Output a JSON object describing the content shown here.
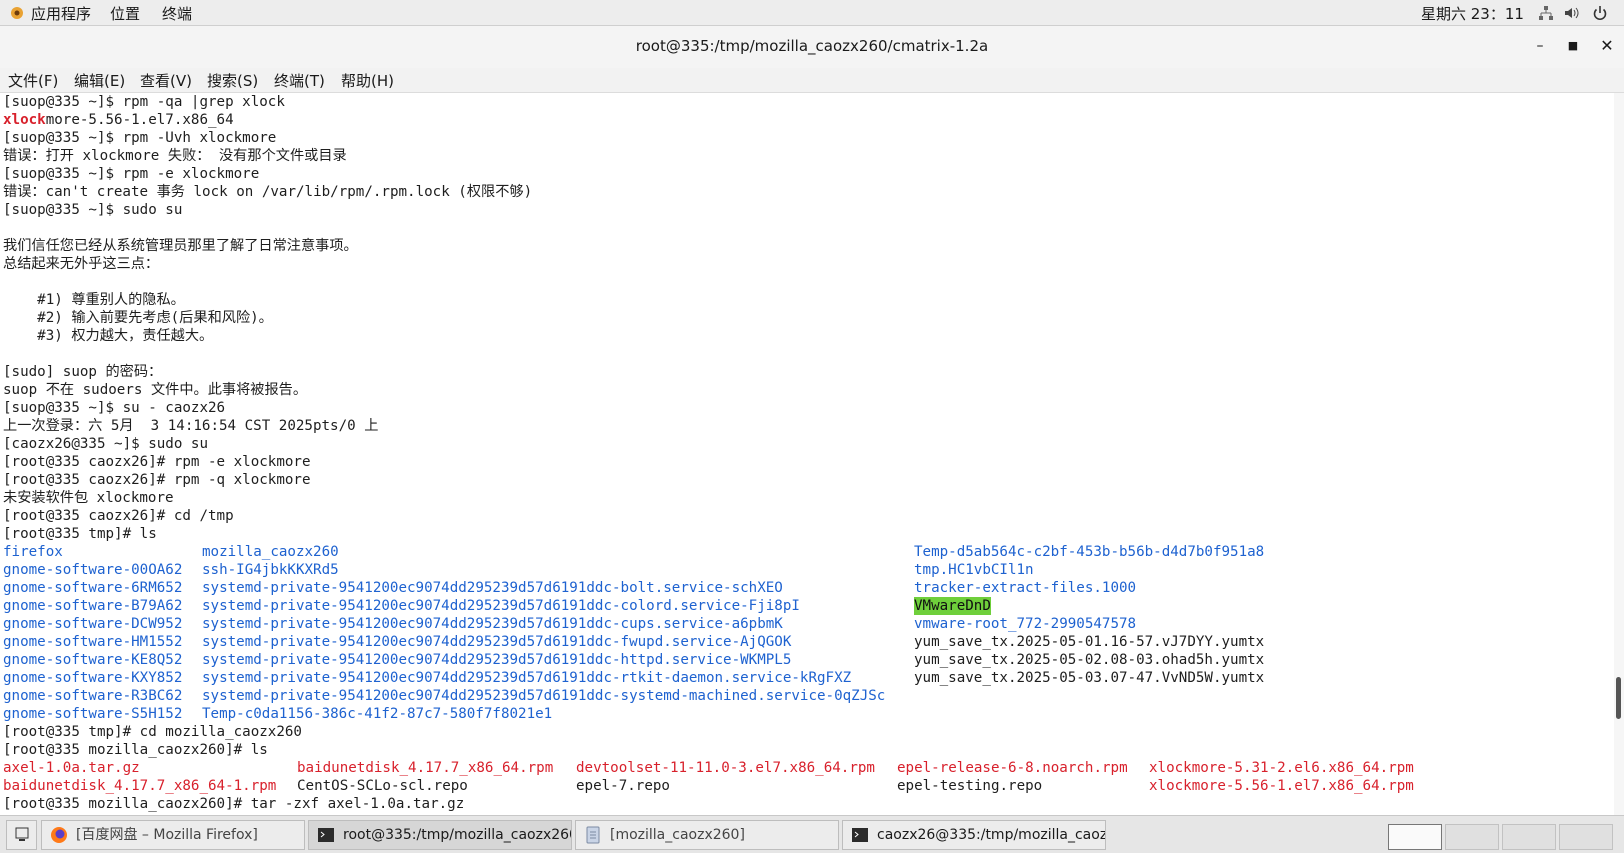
{
  "topbar": {
    "apps_label": "应用程序",
    "places_label": "位置",
    "terminal_label": "终端",
    "clock": "星期六 23：11"
  },
  "window": {
    "title": "root@335:/tmp/mozilla_caozx260/cmatrix-1.2a"
  },
  "menubar": {
    "file": "文件(F)",
    "edit": "编辑(E)",
    "view": "查看(V)",
    "search": "搜索(S)",
    "terminal": "终端(T)",
    "help": "帮助(H)"
  },
  "terminal": {
    "lines": [
      "[suop@335 ~]$ rpm -qa |grep xlock",
      "more-5.56-1.el7.x86_64",
      "[suop@335 ~]$ rpm -Uvh xlockmore",
      "错误：打开 xlockmore 失败： 没有那个文件或目录",
      "[suop@335 ~]$ rpm -e xlockmore",
      "错误：can't create 事务 lock on /var/lib/rpm/.rpm.lock (权限不够)",
      "[suop@335 ~]$ sudo su",
      "",
      "我们信任您已经从系统管理员那里了解了日常注意事项。",
      "总结起来无外乎这三点：",
      "",
      "    #1) 尊重别人的隐私。",
      "    #2) 输入前要先考虑(后果和风险)。",
      "    #3) 权力越大，责任越大。",
      "",
      "[sudo] suop 的密码：",
      "suop 不在 sudoers 文件中。此事将被报告。",
      "[suop@335 ~]$ su - caozx26",
      "上一次登录：六 5月  3 14:16:54 CST 2025pts/0 上",
      "[caozx26@335 ~]$ sudo su",
      "[root@335 caozx26]# rpm -e xlockmore",
      "[root@335 caozx26]# rpm -q xlockmore",
      "未安装软件包 xlockmore",
      "[root@335 caozx26]# cd /tmp",
      "[root@335 tmp]# ls"
    ],
    "grep_match": "xlock",
    "ls_tmp": {
      "col1": [
        "firefox",
        "gnome-software-00OA62",
        "gnome-software-6RM652",
        "gnome-software-B79A62",
        "gnome-software-DCW952",
        "gnome-software-HM1552",
        "gnome-software-KE8Q52",
        "gnome-software-KXY852",
        "gnome-software-R3BC62",
        "gnome-software-S5H152"
      ],
      "col2": [
        "mozilla_caozx260",
        "ssh-IG4jbkKKXRd5",
        "systemd-private-9541200ec9074dd295239d57d6191ddc-bolt.service-schXEO",
        "systemd-private-9541200ec9074dd295239d57d6191ddc-colord.service-Fji8pI",
        "systemd-private-9541200ec9074dd295239d57d6191ddc-cups.service-a6pbmK",
        "systemd-private-9541200ec9074dd295239d57d6191ddc-fwupd.service-AjQGOK",
        "systemd-private-9541200ec9074dd295239d57d6191ddc-httpd.service-WKMPL5",
        "systemd-private-9541200ec9074dd295239d57d6191ddc-rtkit-daemon.service-kRgFXZ",
        "systemd-private-9541200ec9074dd295239d57d6191ddc-systemd-machined.service-0qZJSc",
        "Temp-c0da1156-386c-41f2-87c7-580f7f8021e1"
      ],
      "col3": [
        "Temp-d5ab564c-c2bf-453b-b56b-d4d7b0f951a8",
        "tmp.HC1vbCIl1n",
        "tracker-extract-files.1000",
        "VMwareDnD",
        "vmware-root_772-2990547578",
        "yum_save_tx.2025-05-01.16-57.vJ7DYY.yumtx",
        "yum_save_tx.2025-05-02.08-03.ohad5h.yumtx",
        "yum_save_tx.2025-05-03.07-47.VvND5W.yumtx"
      ]
    },
    "after_lines": [
      "[root@335 tmp]# cd mozilla_caozx260",
      "[root@335 mozilla_caozx260]# ls"
    ],
    "ls_moz": {
      "row1": [
        "axel-1.0a.tar.gz",
        "baidunetdisk_4.17.7_x86_64.rpm",
        "devtoolset-11-11.0-3.el7.x86_64.rpm",
        "epel-release-6-8.noarch.rpm",
        "xlockmore-5.31-2.el6.x86_64.rpm"
      ],
      "row2": [
        "baidunetdisk_4.17.7_x86_64-1.rpm",
        "CentOS-SCLo-scl.repo",
        "epel-7.repo",
        "epel-testing.repo",
        "xlockmore-5.56-1.el7.x86_64.rpm"
      ]
    },
    "last_line": "[root@335 mozilla_caozx260]# tar -zxf axel-1.0a.tar.gz"
  },
  "taskbar": {
    "tasks": [
      "[百度网盘 – Mozilla Firefox]",
      "root@335:/tmp/mozilla_caozx260/…",
      "[mozilla_caozx260]",
      "caozx26@335:/tmp/mozilla_caozx…"
    ]
  },
  "colors": {
    "link_blue": "#1e62d0",
    "archive_red": "#d8212c",
    "dnd_green": "#6fcf3b"
  }
}
